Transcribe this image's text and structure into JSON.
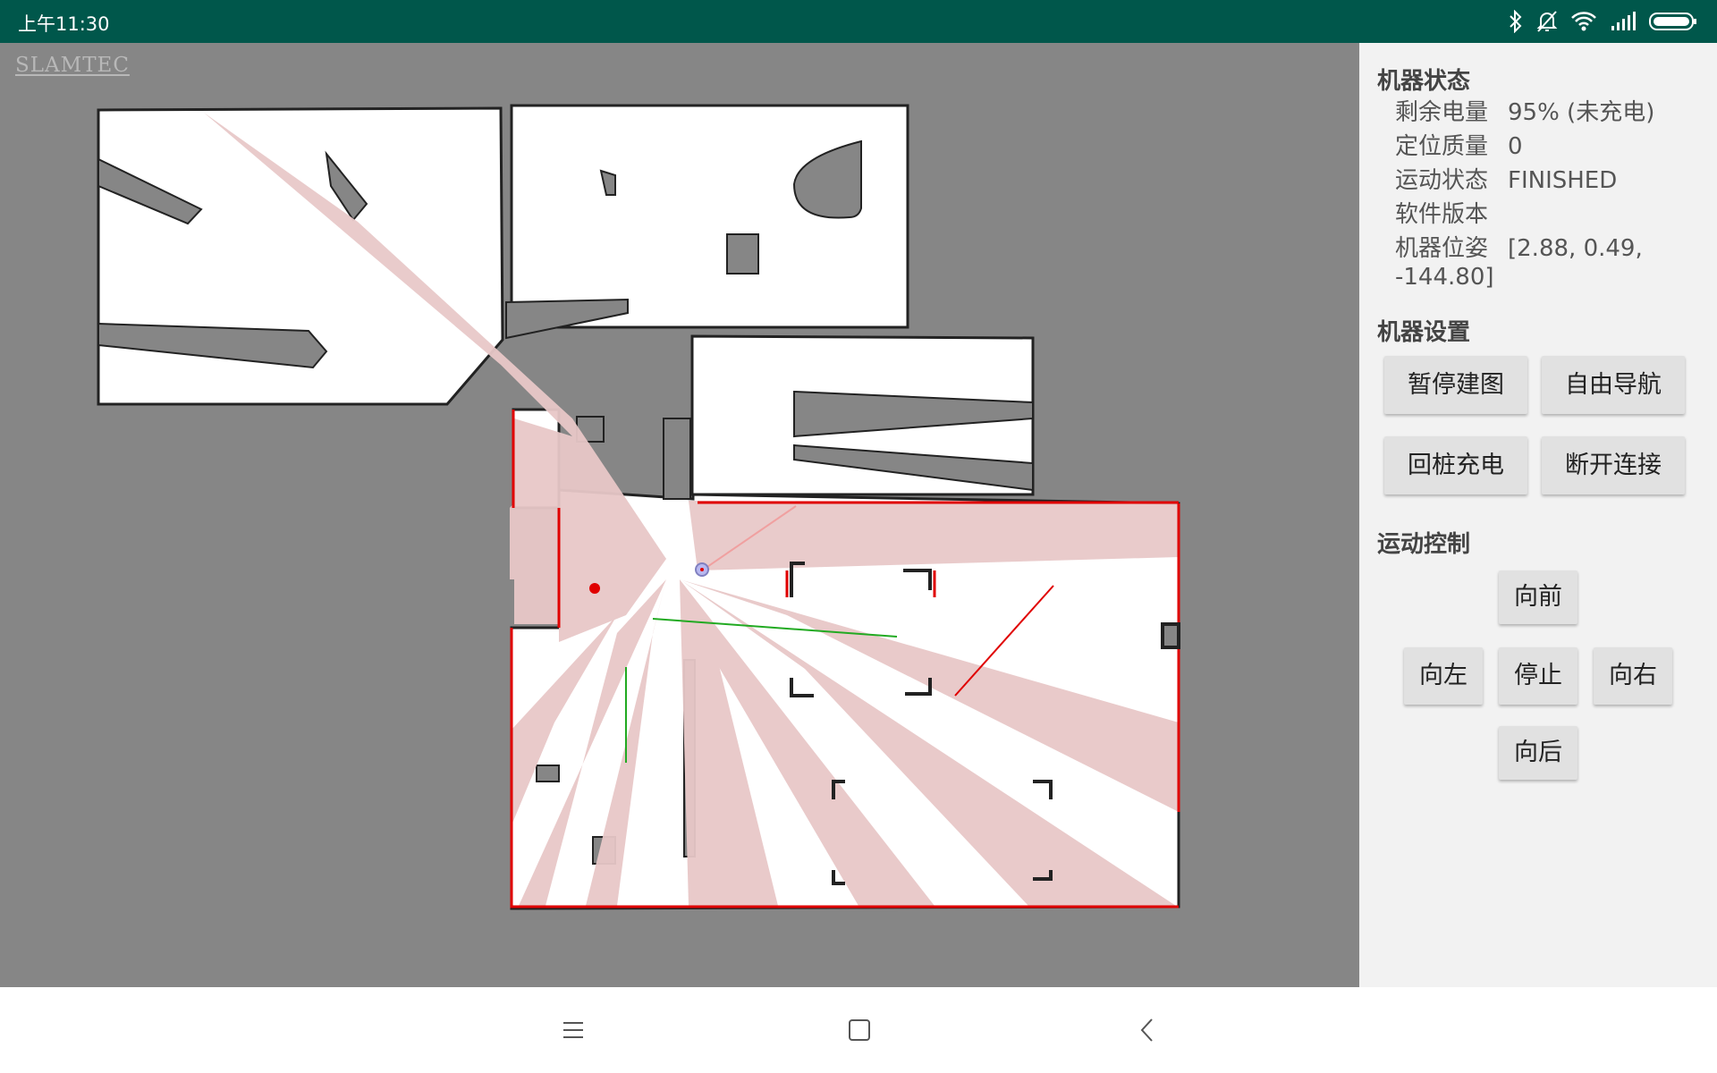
{
  "status_bar": {
    "time": "上午11:30",
    "icons": [
      "bluetooth-icon",
      "mute-notification-icon",
      "wifi-icon",
      "signal-icon",
      "battery-icon"
    ]
  },
  "map": {
    "logo": "SLAMTEC",
    "colors": {
      "background": "#868686",
      "free": "#ffffff",
      "scan": "#e8c8c8",
      "obstacle": "#e00000",
      "path": "#22aa22"
    }
  },
  "panel": {
    "robot_status": {
      "title": "机器状态",
      "battery_label": "剩余电量",
      "battery_value": "95% (未充电)",
      "loc_label": "定位质量",
      "loc_value": "0",
      "motion_label": "运动状态",
      "motion_value": "FINISHED",
      "sw_label": "软件版本",
      "sw_value": "",
      "pose_label": "机器位姿",
      "pose_value": "[2.88, 0.49, -144.80]"
    },
    "robot_settings": {
      "title": "机器设置",
      "pause_mapping": "暂停建图",
      "free_nav": "自由导航",
      "go_charge": "回桩充电",
      "disconnect": "断开连接"
    },
    "motion_control": {
      "title": "运动控制",
      "forward": "向前",
      "left": "向左",
      "stop": "停止",
      "right": "向右",
      "backward": "向后"
    }
  },
  "nav_bar": {
    "icons": [
      "menu-icon",
      "home-icon",
      "back-icon"
    ]
  }
}
